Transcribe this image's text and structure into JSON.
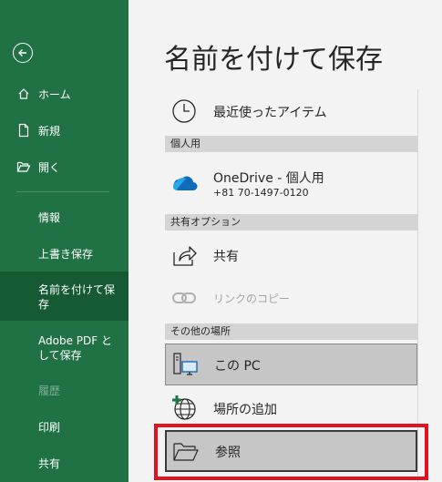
{
  "sidebar": {
    "items": [
      {
        "label": "ホーム"
      },
      {
        "label": "新規"
      },
      {
        "label": "開く"
      },
      {
        "label": "情報"
      },
      {
        "label": "上書き保存"
      },
      {
        "label_line1": "名前を付けて保",
        "label_line2": "存"
      },
      {
        "label_line1": "Adobe PDF と",
        "label_line2": "して保存"
      },
      {
        "label": "履歴"
      },
      {
        "label": "印刷"
      },
      {
        "label": "共有"
      }
    ]
  },
  "main": {
    "title": "名前を付けて保存",
    "recent": {
      "label": "最近使ったアイテム"
    },
    "sections": [
      {
        "header": "個人用"
      },
      {
        "header": "共有オプション"
      },
      {
        "header": "その他の場所"
      }
    ],
    "onedrive": {
      "label": "OneDrive - 個人用",
      "sub": "+81 70-1497-0120"
    },
    "share": {
      "label": "共有"
    },
    "copy_link": {
      "label": "リンクのコピー"
    },
    "this_pc": {
      "label": "この PC"
    },
    "add_place": {
      "label": "場所の追加"
    },
    "browse": {
      "label": "参照"
    }
  },
  "colors": {
    "sidebar_bg": "#207245",
    "sidebar_active": "#165a34",
    "highlight": "#e0141e",
    "onedrive": "#0f6cbd"
  }
}
